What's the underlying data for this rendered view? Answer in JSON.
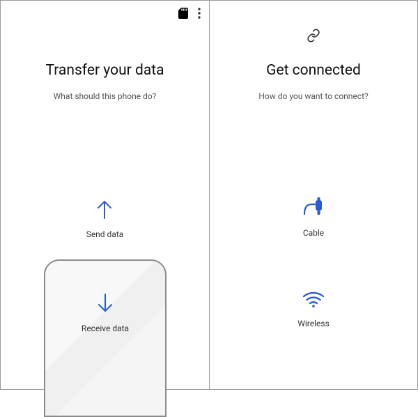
{
  "left": {
    "title": "Transfer your data",
    "subtitle": "What should this phone do?",
    "send": {
      "label": "Send data"
    },
    "receive": {
      "label": "Receive data"
    }
  },
  "right": {
    "title": "Get connected",
    "subtitle": "How do you want to connect?",
    "cable": {
      "label": "Cable"
    },
    "wireless": {
      "label": "Wireless"
    }
  }
}
